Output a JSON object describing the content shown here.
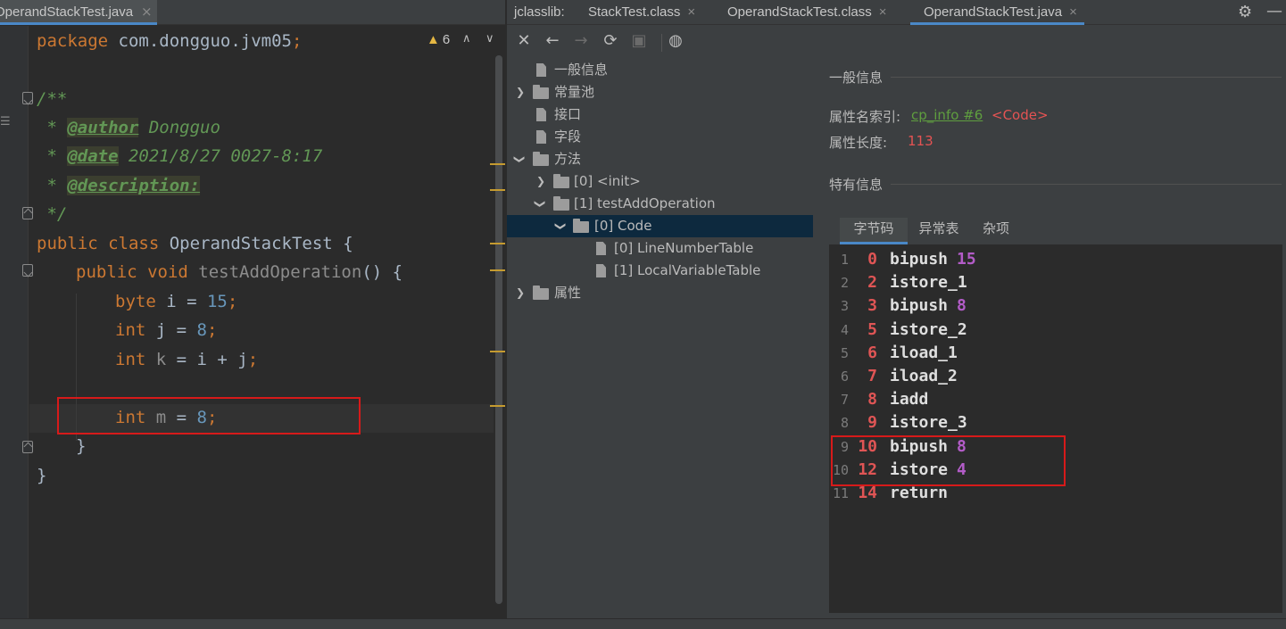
{
  "left_editor": {
    "tab_label": "OperandStackTest.java",
    "tab_close": "×",
    "warning_count": "6",
    "warning_icon": "▲",
    "nav_up": "∧",
    "nav_down": "∨",
    "lines": {
      "l1_kw": "package",
      "l1_rest": " com.dongguo.jvm05",
      "l1_semi": ";",
      "l3": "/**",
      "l4_star": " * ",
      "l4_tag": "@author",
      "l4_text": " Dongguo",
      "l5_star": " * ",
      "l5_tag": "@date",
      "l5_text": " 2021/8/27 0027-8:17",
      "l6_star": " * ",
      "l6_tag": "@description:",
      "l7": " */",
      "l8_kw": "public class",
      "l8_name": " OperandStackTest",
      "l8_brace": " {",
      "l9_kw": "public void",
      "l9_name": " testAddOperation",
      "l9_rest": "() {",
      "l10_kw": "byte",
      "l10_var": " i = ",
      "l10_num": "15",
      "l10_semi": ";",
      "l11_kw": "int",
      "l11_var": " j = ",
      "l11_num": "8",
      "l11_semi": ";",
      "l12_kw": "int",
      "l12_var": " k",
      "l12_rest": " = i + j",
      "l12_semi": ";",
      "l14_kw": "int",
      "l14_var": " m",
      "l14_eq": " = ",
      "l14_num": "8",
      "l14_semi": ";",
      "l15": "}",
      "l16": "}"
    }
  },
  "right_pane": {
    "tabs": {
      "jclasslib": "jclasslib:",
      "t1": "StackTest.class",
      "t2": "OperandStackTest.class",
      "t3": "OperandStackTest.java",
      "close": "×"
    },
    "icons": {
      "settings": "⚙",
      "minimize": "—"
    },
    "toolbar": {
      "close": "✕",
      "back": "←",
      "forward": "→",
      "refresh": "⟳",
      "save": "▣",
      "web": "◍"
    },
    "tree": {
      "general": "一般信息",
      "constant_pool": "常量池",
      "interfaces": "接口",
      "fields": "字段",
      "methods": "方法",
      "init": "[0] <init>",
      "test_add": "[1] testAddOperation",
      "code": "[0] Code",
      "line_number_table": "[0] LineNumberTable",
      "local_variable_table": "[1] LocalVariableTable",
      "attributes": "属性"
    },
    "detail": {
      "general_title": "一般信息",
      "attr_name_index_label": "属性名索引:",
      "cp_link": "cp_info #6",
      "cp_code": "<Code>",
      "attr_length_label": "属性长度:",
      "attr_length": "113",
      "specific_title": "特有信息",
      "tabs": {
        "bytecode": "字节码",
        "exceptions": "异常表",
        "misc": "杂项"
      }
    },
    "bytecode": [
      {
        "ln": "1",
        "off": "0",
        "op": "bipush",
        "arg": "15"
      },
      {
        "ln": "2",
        "off": "2",
        "op": "istore_1",
        "arg": ""
      },
      {
        "ln": "3",
        "off": "3",
        "op": "bipush",
        "arg": "8"
      },
      {
        "ln": "4",
        "off": "5",
        "op": "istore_2",
        "arg": ""
      },
      {
        "ln": "5",
        "off": "6",
        "op": "iload_1",
        "arg": ""
      },
      {
        "ln": "6",
        "off": "7",
        "op": "iload_2",
        "arg": ""
      },
      {
        "ln": "7",
        "off": "8",
        "op": "iadd",
        "arg": ""
      },
      {
        "ln": "8",
        "off": "9",
        "op": "istore_3",
        "arg": ""
      },
      {
        "ln": "9",
        "off": "10",
        "op": "bipush",
        "arg": "8"
      },
      {
        "ln": "10",
        "off": "12",
        "op": "istore",
        "arg": "4"
      },
      {
        "ln": "11",
        "off": "14",
        "op": "return",
        "arg": ""
      }
    ]
  }
}
